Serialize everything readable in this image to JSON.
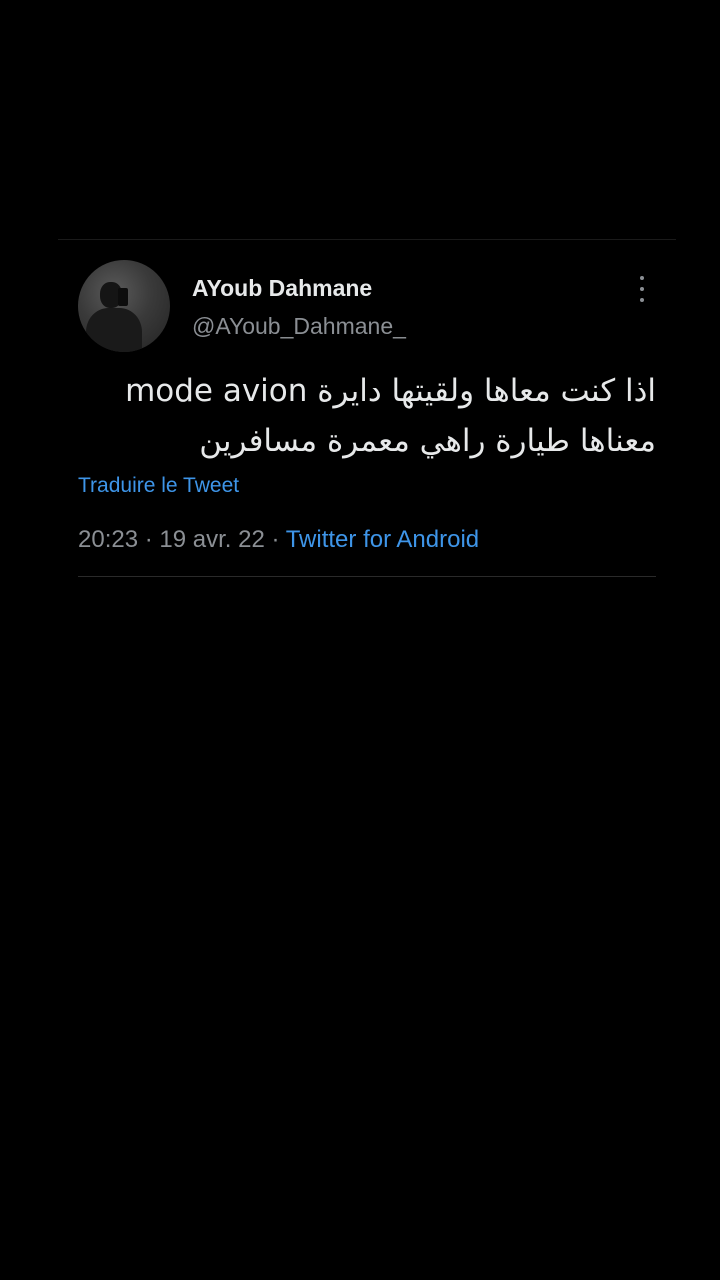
{
  "tweet": {
    "display_name": "AYoub Dahmane",
    "handle": "@AYoub_Dahmane_",
    "text_line1": "اذا كنت معاها ولقيتها دايرة mode avion",
    "text_line2": "معناها طيارة راهي معمرة مسافرين",
    "translate_label": "Traduire le Tweet",
    "time": "20:23",
    "separator": " · ",
    "date": "19 avr. 22",
    "source": "Twitter for Android"
  },
  "icons": {
    "more": "more-vertical-icon"
  },
  "colors": {
    "background": "#000000",
    "link": "#3e95e8",
    "muted": "#8b8f94",
    "text": "#e7e9ea"
  }
}
